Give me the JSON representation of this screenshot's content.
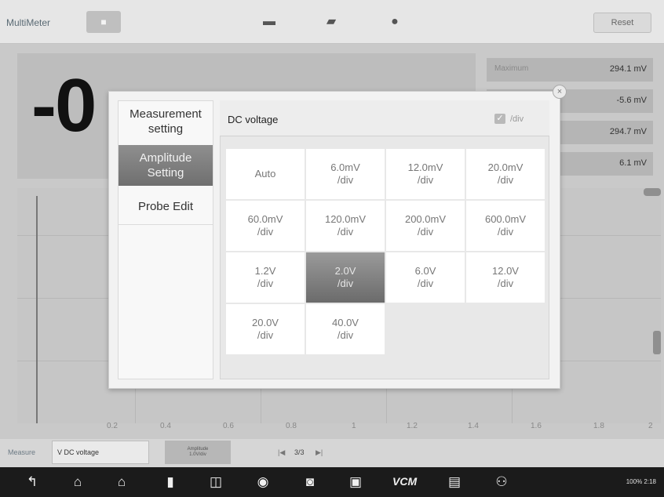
{
  "app": {
    "title": "MultiMeter",
    "reset_label": "Reset",
    "reading": "-0"
  },
  "stats": [
    {
      "label": "Maximum",
      "value": "294.1 mV"
    },
    {
      "label": "",
      "value": "-5.6 mV"
    },
    {
      "label": "",
      "value": "294.7 mV"
    },
    {
      "label": "",
      "value": "6.1 mV"
    }
  ],
  "graph": {
    "x_ticks": [
      "0.2",
      "0.4",
      "0.6",
      "0.8",
      "1",
      "1.2",
      "1.4",
      "1.6",
      "1.8",
      "2"
    ]
  },
  "status_bar": {
    "mode_label": "Measure",
    "mode_value": "V  DC voltage",
    "amplitude_button_line1": "Amplitude",
    "amplitude_button_line2": "1.0V/div",
    "prev": "|◀",
    "page": "3/3",
    "next": "▶|"
  },
  "modal": {
    "menu": [
      {
        "label_line1": "Measurement",
        "label_line2": "setting",
        "selected": false
      },
      {
        "label_line1": "Amplitude",
        "label_line2": "Setting",
        "selected": true
      },
      {
        "label_line1": "Probe Edit",
        "label_line2": "",
        "selected": false
      }
    ],
    "title": "DC voltage",
    "div_toggle_label": "/div",
    "options": [
      {
        "line1": "Auto",
        "line2": ""
      },
      {
        "line1": "6.0mV",
        "line2": "/div"
      },
      {
        "line1": "12.0mV",
        "line2": "/div"
      },
      {
        "line1": "20.0mV",
        "line2": "/div"
      },
      {
        "line1": "60.0mV",
        "line2": "/div"
      },
      {
        "line1": "120.0mV",
        "line2": "/div"
      },
      {
        "line1": "200.0mV",
        "line2": "/div"
      },
      {
        "line1": "600.0mV",
        "line2": "/div"
      },
      {
        "line1": "1.2V",
        "line2": "/div"
      },
      {
        "line1": "2.0V",
        "line2": "/div"
      },
      {
        "line1": "6.0V",
        "line2": "/div"
      },
      {
        "line1": "12.0V",
        "line2": "/div"
      },
      {
        "line1": "20.0V",
        "line2": "/div"
      },
      {
        "line1": "40.0V",
        "line2": "/div"
      }
    ],
    "selected_option": "2.0V /div"
  },
  "navbar": {
    "icons": [
      "back-icon",
      "home-icon",
      "house-icon",
      "recent-apps-icon",
      "split-screen-icon",
      "browser-icon",
      "camera-icon",
      "display-icon",
      "vci-icon",
      "car-icon",
      "remote-expert-icon"
    ],
    "vci_label": "VCM",
    "system_status": "100%  2:18"
  },
  "colors": {
    "selected_gradient_top": "#9a9a9a",
    "selected_gradient_bottom": "#6b6b6b",
    "navbar": "#1b1b1b"
  }
}
